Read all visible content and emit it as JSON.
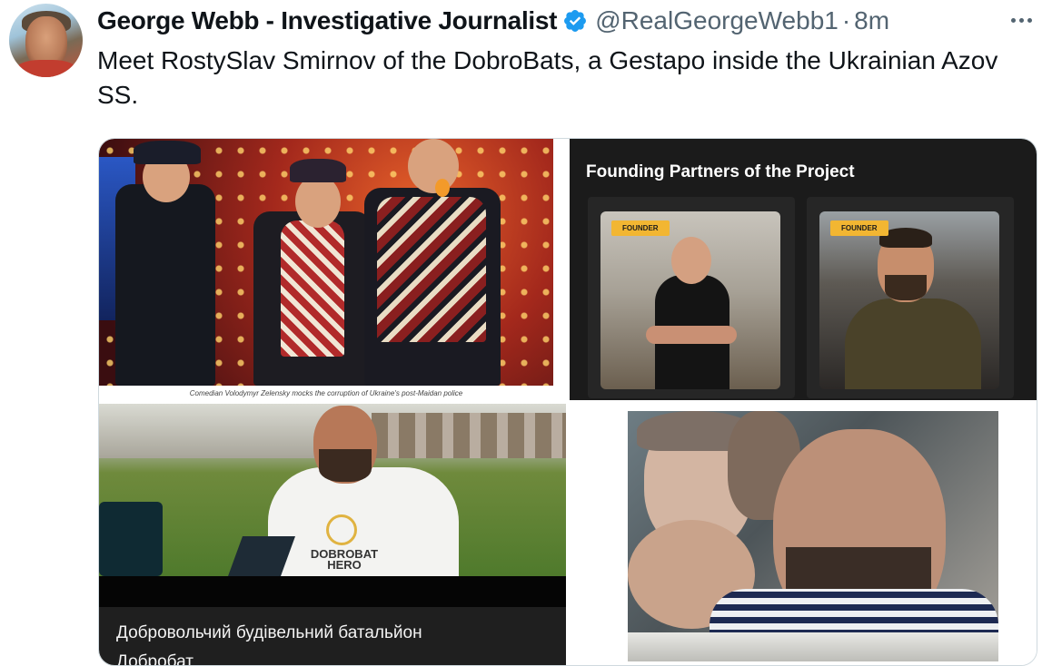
{
  "tweet": {
    "author_name": "George Webb - Investigative Journalist",
    "handle": "@RealGeorgeWebb1",
    "separator": "·",
    "time": "8m",
    "text": "Meet RostySlav Smirnov of the DobroBats, a Gestapo inside the Ukrainian Azov SS."
  },
  "media": {
    "panel1": {
      "caption": "Comedian Volodymyr Zelensky mocks the corruption of Ukraine's post-Maidan police"
    },
    "panel2": {
      "title": "Founding Partners of the Project",
      "badges": [
        "FOUNDER",
        "FOUNDER"
      ]
    },
    "panel3": {
      "shirt_text_line1": "DOBROBAT",
      "shirt_text_line2": "HERO",
      "caption_line1": "Добровольчий будівельний батальйон",
      "caption_line2": "Добробат"
    }
  },
  "icons": {
    "verified": "verified-badge-icon",
    "more": "more-options-icon"
  },
  "colors": {
    "text_primary": "#0f1419",
    "text_secondary": "#536471",
    "verified_blue": "#1d9bf0",
    "founder_badge": "#f2b632",
    "partners_bg": "#1b1b1b"
  }
}
